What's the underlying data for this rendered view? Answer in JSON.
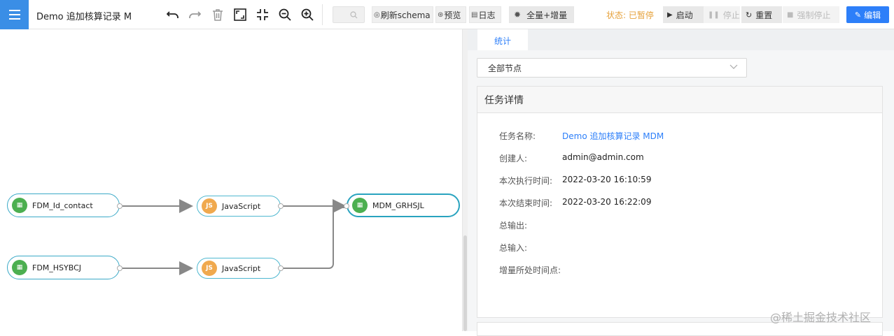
{
  "toolbar": {
    "title": "Demo 追加核算记录 MDM",
    "buttons": {
      "refresh_schema": "刷新schema",
      "preview": "预览",
      "log": "日志",
      "sync_mode": "全量+增量"
    },
    "status_label": "状态: 已暂停",
    "controls": {
      "start": "启动",
      "stop": "停止",
      "reset": "重置",
      "force_stop": "强制停止"
    },
    "edit": "编辑"
  },
  "canvas": {
    "nodes": [
      {
        "label": "FDM_Id_contact",
        "icon": "grid-icon"
      },
      {
        "label": "JavaScript",
        "icon": "js-icon"
      },
      {
        "label": "MDM_GRHSJL",
        "icon": "grid-icon"
      },
      {
        "label": "FDM_HSYBCJ",
        "icon": "grid-icon"
      },
      {
        "label": "JavaScript",
        "icon": "js-icon"
      }
    ]
  },
  "panel": {
    "tab": "统计",
    "node_filter": "全部节点",
    "card_title": "任务详情",
    "details": [
      {
        "key": "任务名称:",
        "value": "Demo 追加核算记录 MDM"
      },
      {
        "key": "创建人:",
        "value": "admin@admin.com"
      },
      {
        "key": "本次执行时间:",
        "value": "2022-03-20 16:10:59"
      },
      {
        "key": "本次结束时间:",
        "value": "2022-03-20 16:22:09"
      },
      {
        "key": "总输出:",
        "value": ""
      },
      {
        "key": "总输入:",
        "value": ""
      },
      {
        "key": "增量所处时间点:",
        "value": ""
      }
    ]
  },
  "watermark": "@稀土掘金技术社区",
  "colors": {
    "accent": "#2d7ff9",
    "menu": "#3a8ee6",
    "status": "#e6a23c",
    "node_border": "#3aa9c7",
    "source_icon": "#4caf50",
    "js_icon": "#f0a94e"
  }
}
